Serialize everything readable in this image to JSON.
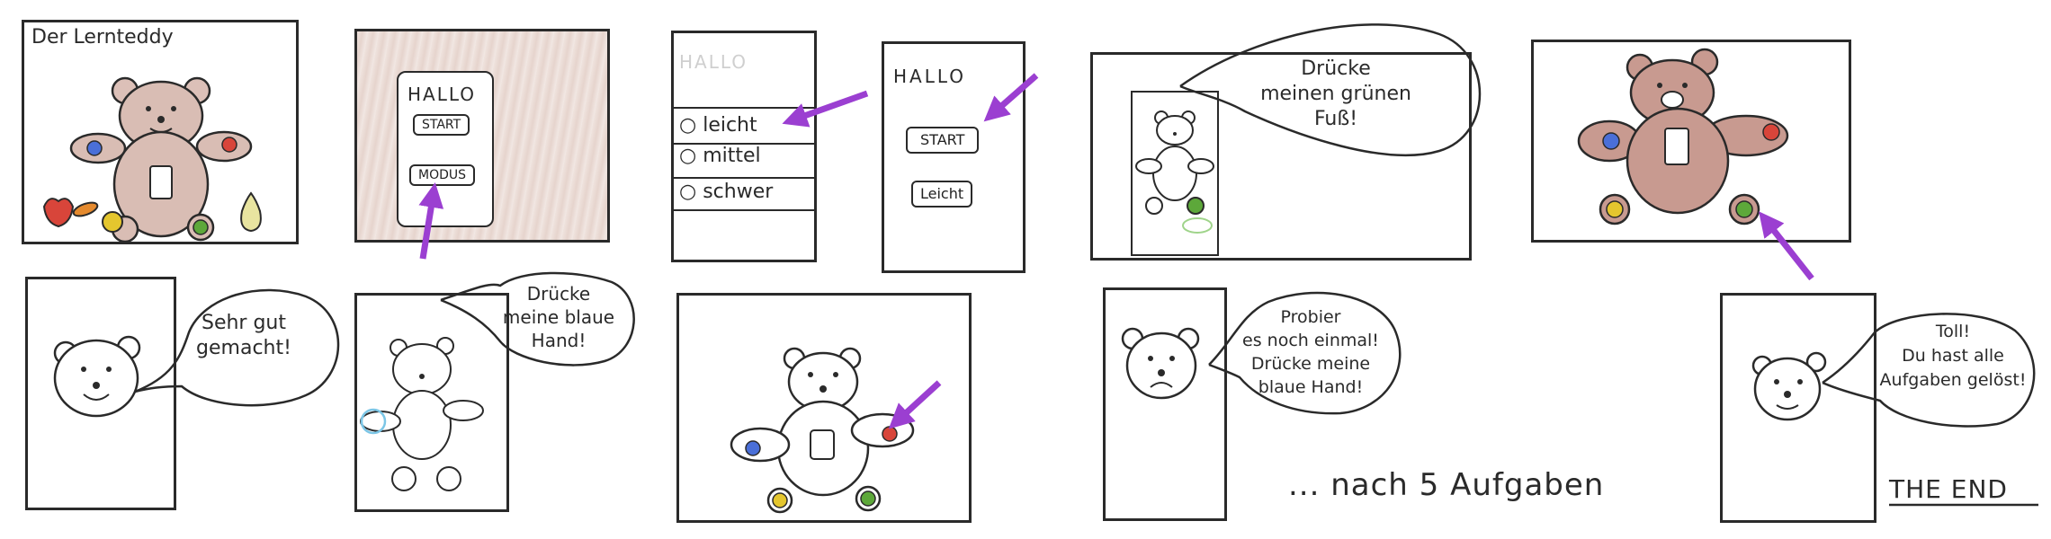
{
  "panels": {
    "p1": {
      "title": "Der Lernteddy"
    },
    "p2": {
      "heading": "HALLO",
      "start": "START",
      "modus": "MODUS"
    },
    "p3": {
      "heading": "HALLO",
      "options": [
        "leicht",
        "mittel",
        "schwer"
      ]
    },
    "p4": {
      "heading": "HALLO",
      "start": "START",
      "level": "Leicht"
    },
    "p5": {
      "speech": [
        "Drücke",
        "meinen grünen",
        "Fuß!"
      ]
    },
    "p7": {
      "speech": [
        "Sehr gut",
        "gemacht!"
      ]
    },
    "p8": {
      "speech": [
        "Drücke",
        "meine blaue",
        "Hand!"
      ]
    },
    "p10": {
      "speech": [
        "Probier",
        "es noch einmal!",
        "Drücke meine",
        "blaue Hand!"
      ]
    },
    "p11": {
      "speech": [
        "Toll!",
        "Du hast alle",
        "Aufgaben gelöst!"
      ]
    }
  },
  "captions": {
    "after": "... nach 5 Aufgaben",
    "end": "THE END"
  },
  "colors": {
    "ink": "#2a2a2a",
    "arrow": "#9b3fd1",
    "teddy_brown": "#a9736a",
    "blue": "#4a6fd8",
    "green": "#5da83a",
    "yellow": "#e4c62e",
    "red": "#d8453a"
  }
}
